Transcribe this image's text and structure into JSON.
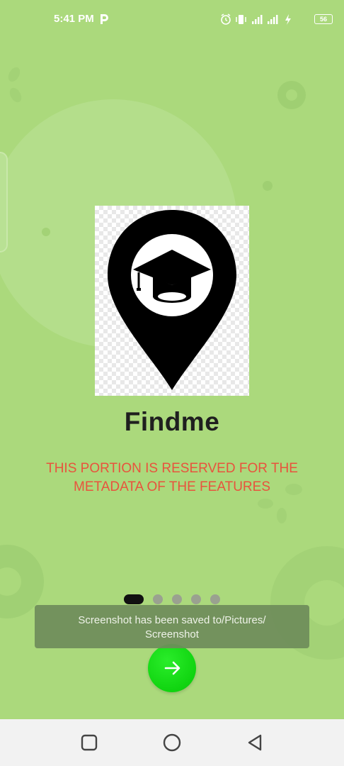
{
  "status_bar": {
    "time": "5:41 PM",
    "battery": "56",
    "icons": [
      "p-icon",
      "alarm-icon",
      "vibrate-icon",
      "signal-icon",
      "signal-icon",
      "charging-icon",
      "battery-icon"
    ]
  },
  "onboarding": {
    "title": "Findme",
    "metadata_line1": "THIS PORTION IS RESERVED FOR THE",
    "metadata_line2": "METADATA OF THE FEATURES",
    "page_count": 5,
    "current_page": 1,
    "next_icon": "arrow-right-icon",
    "logo_icon": "location-pin-graduation-cap-icon"
  },
  "toast": {
    "line1": "Screenshot has been saved to/Pictures/",
    "line2": "Screenshot"
  },
  "nav_bar": {
    "icons": [
      "recent-apps-icon",
      "home-icon",
      "back-icon"
    ]
  },
  "colors": {
    "background": "#abd97c",
    "accent_green": "#10d410",
    "metadata_red": "#e8533d",
    "title_dark": "#1f1f1f"
  }
}
